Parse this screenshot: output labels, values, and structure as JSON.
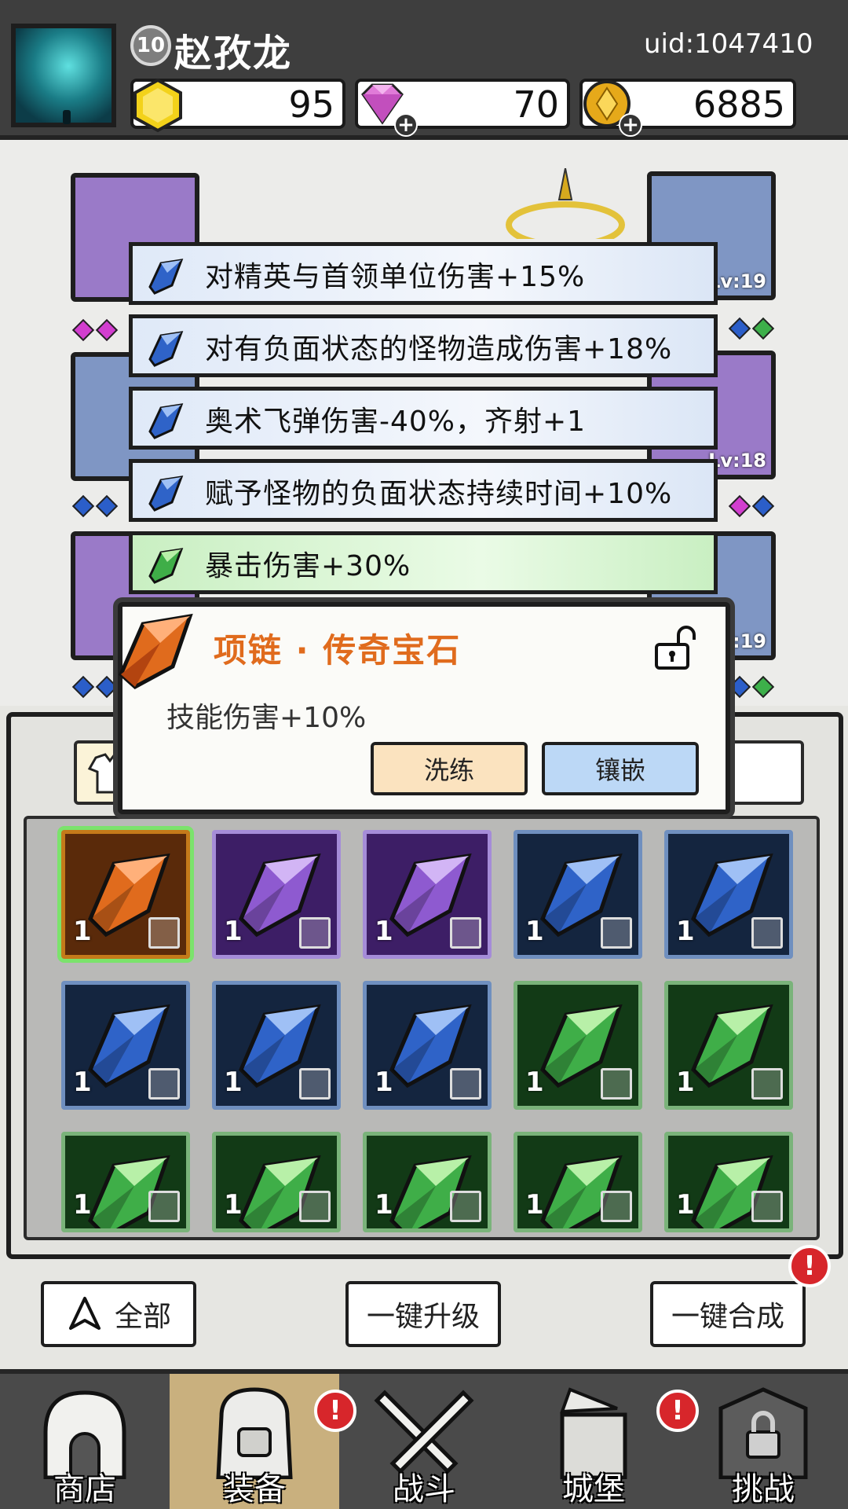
{
  "header": {
    "level": "10",
    "player_name": "赵孜龙",
    "uid": "uid:1047410",
    "currencies": [
      {
        "icon": "yellow-gem-icon",
        "value": "95"
      },
      {
        "icon": "diamond-icon",
        "value": "70"
      },
      {
        "icon": "gold-coin-icon",
        "value": "6885"
      }
    ]
  },
  "equipment": {
    "slots": [
      {
        "lv": "Lv:19"
      },
      {
        "lv": "Lv:18"
      },
      {
        "lv": "Lv:19"
      }
    ]
  },
  "skills": [
    {
      "text": "对精英与首领单位伤害+15%",
      "color": "blue"
    },
    {
      "text": "对有负面状态的怪物造成伤害+18%",
      "color": "blue"
    },
    {
      "text": "奥术飞弹伤害-40%，齐射+1",
      "color": "blue"
    },
    {
      "text": "赋予怪物的负面状态持续时间+10%",
      "color": "blue"
    },
    {
      "text": "暴击伤害+30%",
      "color": "green"
    }
  ],
  "detail": {
    "title": "项链 · 传奇宝石",
    "description": "技能伤害+10%",
    "refine_label": "洗练",
    "inlay_label": "镶嵌"
  },
  "inventory": {
    "items": [
      {
        "count": "1",
        "color": "orange",
        "slot": "necklace"
      },
      {
        "count": "1",
        "color": "purple",
        "slot": "ring"
      },
      {
        "count": "1",
        "color": "purple",
        "slot": "hat"
      },
      {
        "count": "1",
        "color": "blue",
        "slot": "armor"
      },
      {
        "count": "1",
        "color": "blue",
        "slot": "armor"
      },
      {
        "count": "1",
        "color": "blue",
        "slot": "armor"
      },
      {
        "count": "1",
        "color": "blue",
        "slot": "boots"
      },
      {
        "count": "1",
        "color": "blue",
        "slot": "boots"
      },
      {
        "count": "1",
        "color": "green",
        "slot": "armor"
      },
      {
        "count": "1",
        "color": "green",
        "slot": "armor"
      },
      {
        "count": "1",
        "color": "green",
        "slot": "armor"
      },
      {
        "count": "1",
        "color": "green",
        "slot": "boots"
      },
      {
        "count": "1",
        "color": "green",
        "slot": "boots"
      },
      {
        "count": "1",
        "color": "green",
        "slot": "ring"
      },
      {
        "count": "1",
        "color": "green",
        "slot": "ring"
      }
    ]
  },
  "actions": {
    "all_label": "全部",
    "upgrade_label": "一键升级",
    "merge_label": "一键合成",
    "merge_badge": "!"
  },
  "nav": [
    {
      "label": "商店",
      "badge": ""
    },
    {
      "label": "装备",
      "badge": "!"
    },
    {
      "label": "战斗",
      "badge": ""
    },
    {
      "label": "城堡",
      "badge": "!"
    },
    {
      "label": "挑战",
      "badge": ""
    }
  ],
  "colors": {
    "orange": "#e06b1d",
    "blue_gem": "#2f63c8",
    "green_gem": "#3fae48",
    "purple_gem": "#8e5ad0",
    "notif": "#d7262b"
  }
}
